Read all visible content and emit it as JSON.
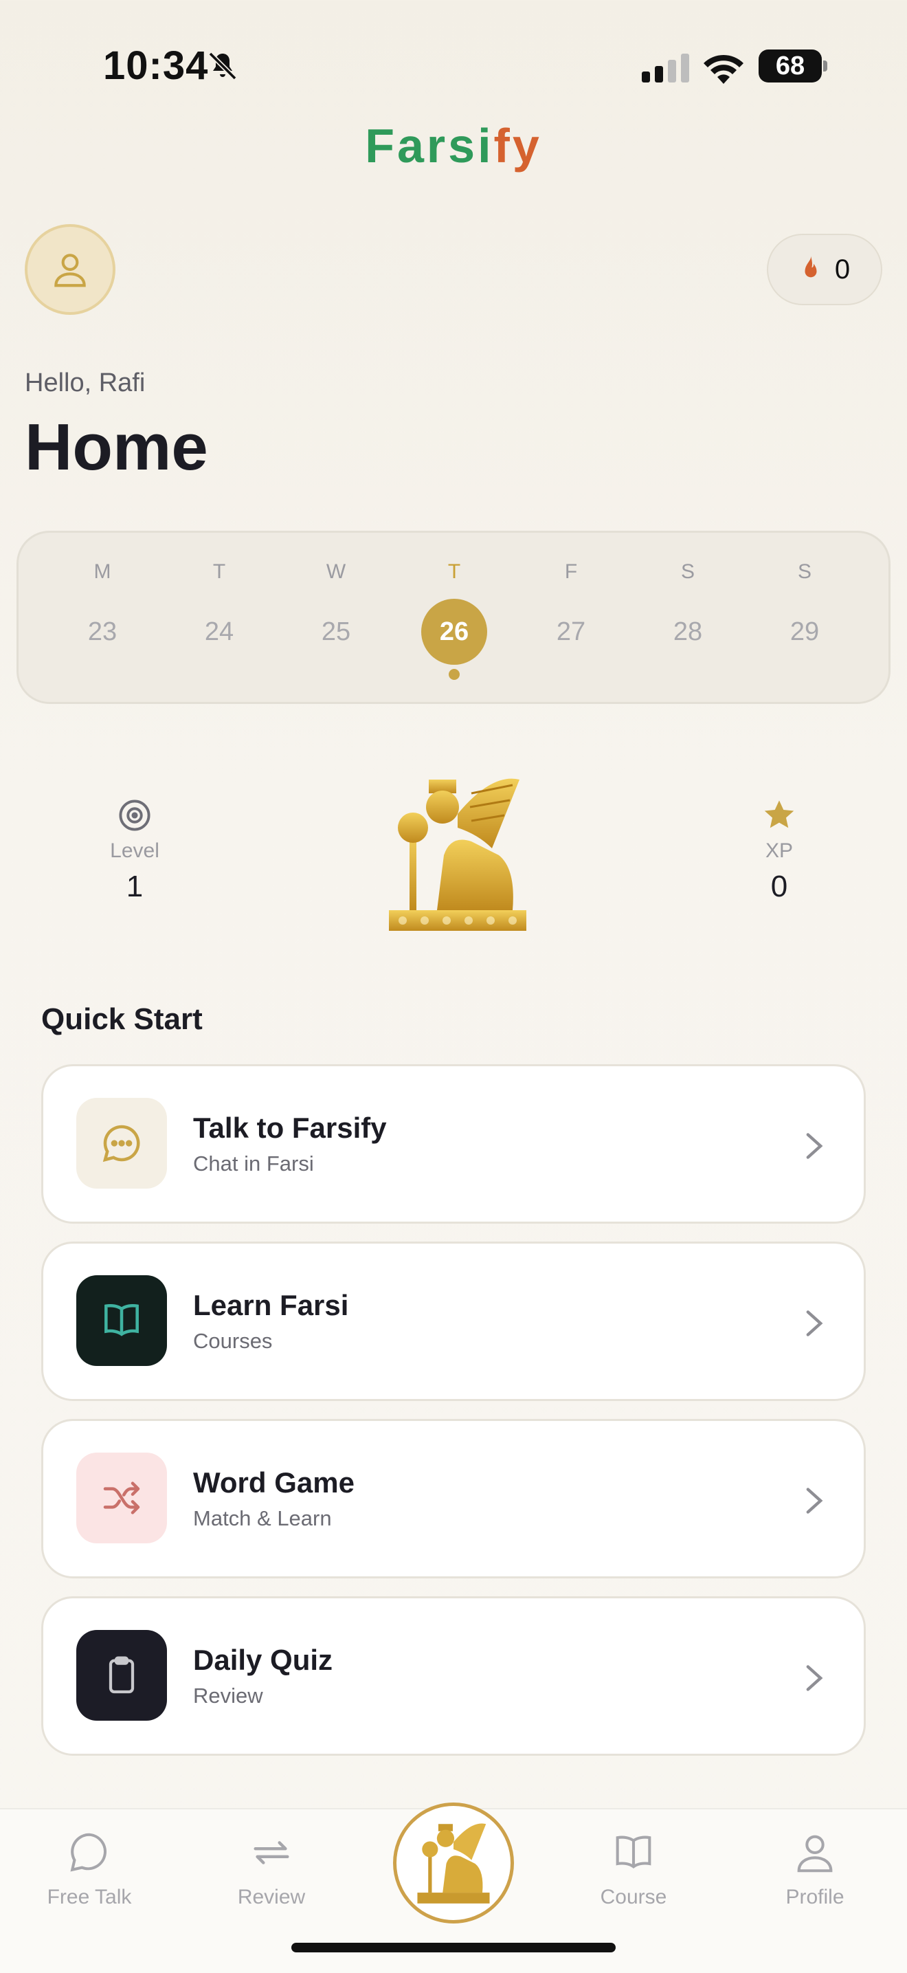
{
  "status_bar": {
    "time": "10:34",
    "battery": "68"
  },
  "brand": {
    "part1": "Farsi",
    "part2": "fy",
    "color_green": "#2f9a5a",
    "color_orange": "#d5622f"
  },
  "header": {
    "streak_count": "0",
    "greeting": "Hello, Rafi",
    "title": "Home"
  },
  "week": {
    "days": [
      {
        "letter": "M",
        "num": "23"
      },
      {
        "letter": "T",
        "num": "24"
      },
      {
        "letter": "W",
        "num": "25"
      },
      {
        "letter": "T",
        "num": "26",
        "active": true
      },
      {
        "letter": "F",
        "num": "27"
      },
      {
        "letter": "S",
        "num": "28"
      },
      {
        "letter": "S",
        "num": "29"
      }
    ]
  },
  "stats": {
    "level": {
      "label": "Level",
      "value": "1",
      "icon": "target-icon"
    },
    "xp": {
      "label": "XP",
      "value": "0",
      "icon": "star-icon"
    }
  },
  "quick_start": {
    "heading": "Quick Start",
    "items": [
      {
        "title": "Talk to Farsify",
        "subtitle": "Chat in Farsi",
        "icon": "chat-bubble-icon"
      },
      {
        "title": "Learn Farsi",
        "subtitle": "Courses",
        "icon": "book-icon"
      },
      {
        "title": "Word Game",
        "subtitle": "Match & Learn",
        "icon": "shuffle-icon"
      },
      {
        "title": "Daily Quiz",
        "subtitle": "Review",
        "icon": "clipboard-icon"
      }
    ]
  },
  "tabbar": {
    "tabs": [
      {
        "label": "Free Talk",
        "icon": "chat-icon"
      },
      {
        "label": "Review",
        "icon": "repeat-icon"
      },
      {
        "label": "Course",
        "icon": "book-icon"
      },
      {
        "label": "Profile",
        "icon": "person-icon"
      }
    ]
  },
  "colors": {
    "gold": "#c9a546",
    "dark_tile": "#12201d",
    "pink_tile": "#fbe4e4",
    "cream_tile": "#f4efe4"
  }
}
